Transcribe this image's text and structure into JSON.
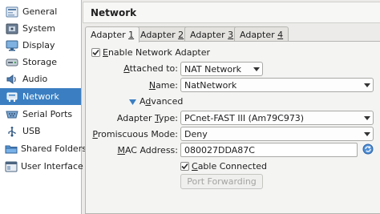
{
  "sidebar": {
    "items": [
      {
        "label": "General",
        "icon": "general-icon"
      },
      {
        "label": "System",
        "icon": "system-icon"
      },
      {
        "label": "Display",
        "icon": "display-icon"
      },
      {
        "label": "Storage",
        "icon": "storage-icon"
      },
      {
        "label": "Audio",
        "icon": "audio-icon"
      },
      {
        "label": "Network",
        "icon": "network-icon",
        "selected": true
      },
      {
        "label": "Serial Ports",
        "icon": "serial-ports-icon"
      },
      {
        "label": "USB",
        "icon": "usb-icon"
      },
      {
        "label": "Shared Folders",
        "icon": "shared-folders-icon"
      },
      {
        "label": "User Interface",
        "icon": "user-interface-icon"
      }
    ]
  },
  "header": {
    "title": "Network"
  },
  "tabs": [
    {
      "label_pre": "Adapter ",
      "label_u": "1",
      "active": true
    },
    {
      "label_pre": "Adapter ",
      "label_u": "2"
    },
    {
      "label_pre": "Adapter ",
      "label_u": "3"
    },
    {
      "label_pre": "Adapter ",
      "label_u": "4"
    }
  ],
  "adapter": {
    "enable_label_u": "E",
    "enable_label_rest": "nable Network Adapter",
    "enable_checked": true,
    "attached_label_u": "A",
    "attached_label_rest": "ttached to:",
    "attached_value": "NAT Network",
    "name_label_u": "N",
    "name_label_rest": "ame:",
    "name_value": "NatNetwork",
    "advanced_label_u": "d",
    "advanced_label_pre": "A",
    "advanced_label_rest": "vanced",
    "adapter_type_label_pre": "Adapter ",
    "adapter_type_label_u": "T",
    "adapter_type_label_rest": "ype:",
    "adapter_type_value": "PCnet-FAST III (Am79C973)",
    "promisc_label_u": "P",
    "promisc_label_rest": "romiscuous Mode:",
    "promisc_value": "Deny",
    "mac_label_pre": "",
    "mac_label_u": "M",
    "mac_label_rest": "AC Address:",
    "mac_value": "080027DDA87C",
    "cable_label_u": "C",
    "cable_label_rest": "able Connected",
    "cable_checked": true,
    "port_forwarding_label": "Port Forwarding"
  }
}
